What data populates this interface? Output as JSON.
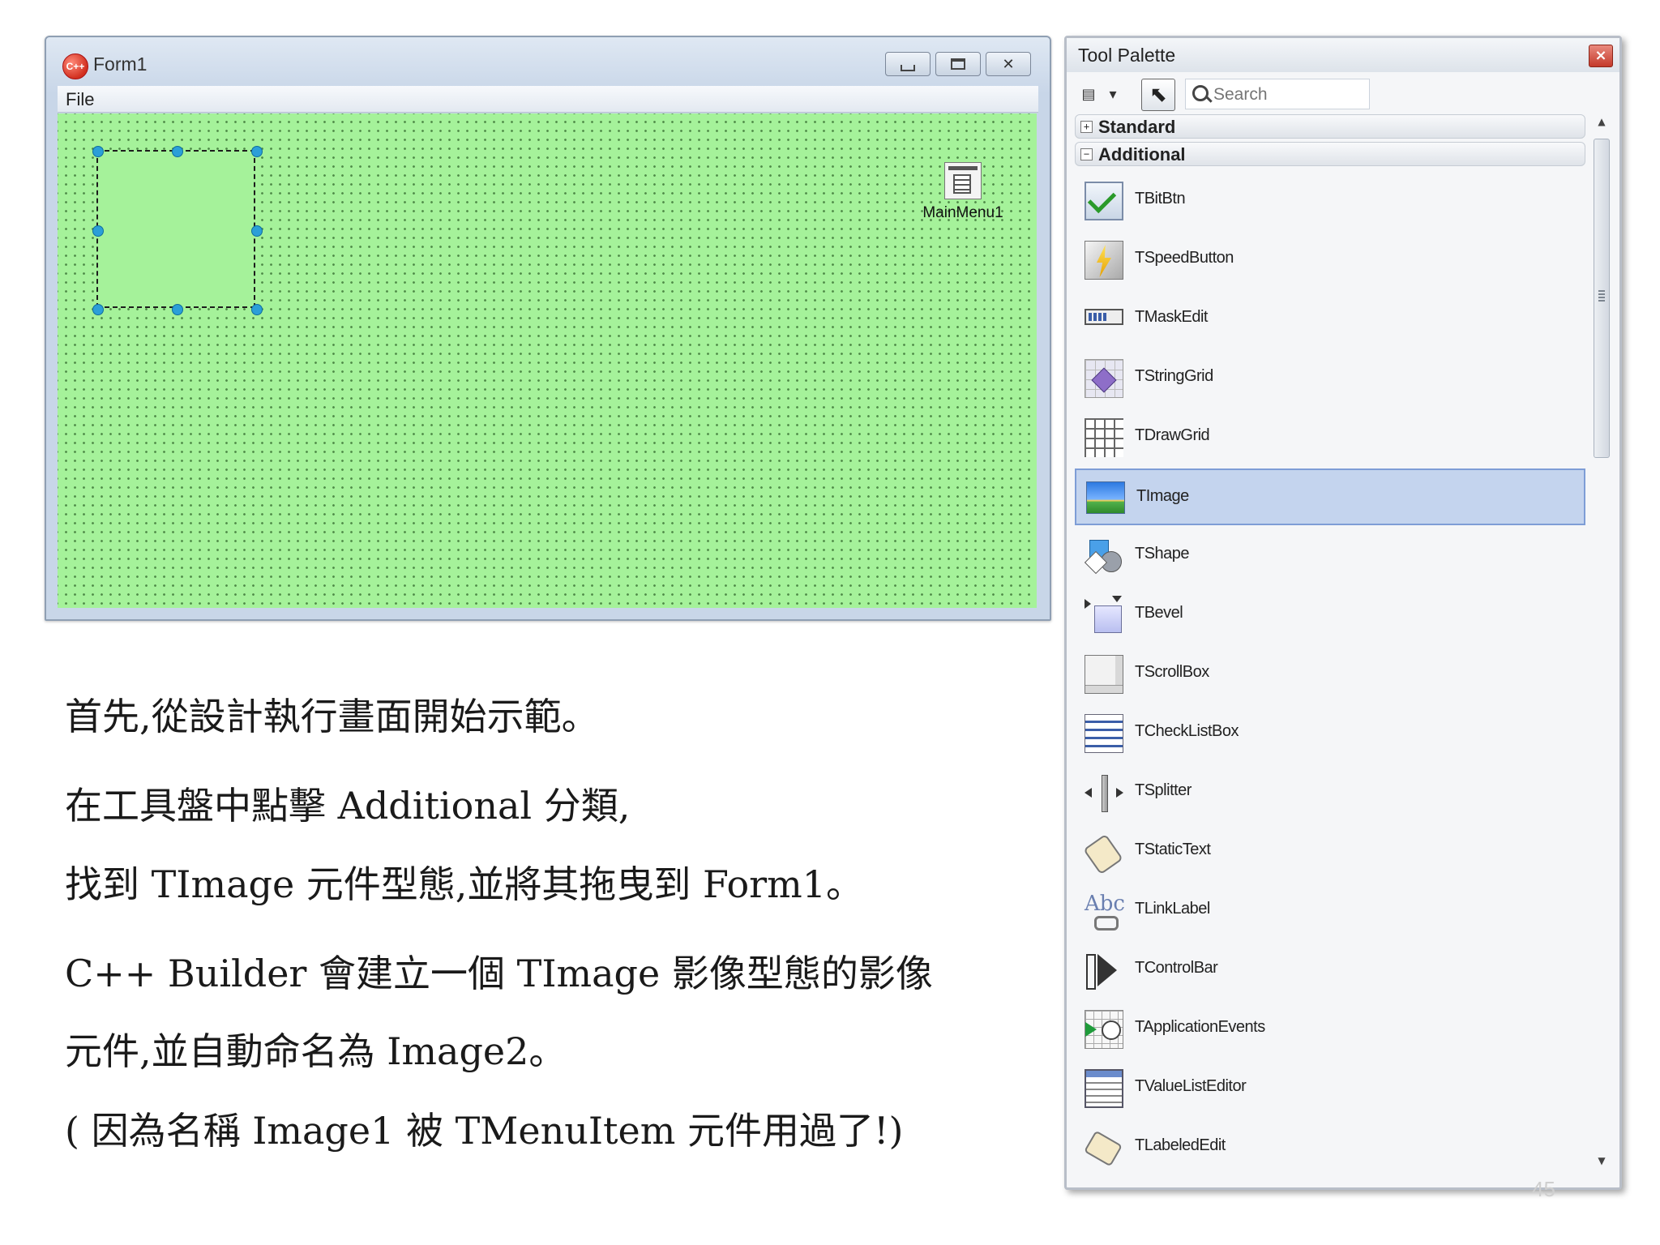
{
  "form_window": {
    "title": "Form1",
    "app_icon_text": "C++",
    "menu": {
      "file": "File"
    },
    "nonvisual_component": {
      "label": "MainMenu1",
      "icon": "mainmenu-icon"
    }
  },
  "caption_lines": [
    "首先,從設計執行畫面開始示範。",
    "在工具盤中點擊 Additional 分類,",
    "找到 TImage 元件型態,並將其拖曳到 Form1。",
    "C++ Builder 會建立一個 TImage 影像型態的影像",
    "元件,並自動命名為 Image2。",
    "( 因為名稱 Image1 被 TMenuItem 元件用過了!)"
  ],
  "tool_palette": {
    "title": "Tool Palette",
    "close_glyph": "×",
    "search_placeholder": "Search",
    "categories": [
      {
        "label": "Standard",
        "toggle": "+",
        "expanded": false
      },
      {
        "label": "Additional",
        "toggle": "−",
        "expanded": true
      }
    ],
    "components": [
      {
        "label": "TBitBtn",
        "icon": "bitbtn-icon"
      },
      {
        "label": "TSpeedButton",
        "icon": "speedbutton-icon"
      },
      {
        "label": "TMaskEdit",
        "icon": "maskedit-icon"
      },
      {
        "label": "TStringGrid",
        "icon": "stringgrid-icon"
      },
      {
        "label": "TDrawGrid",
        "icon": "drawgrid-icon"
      },
      {
        "label": "TImage",
        "icon": "image-icon",
        "selected": true
      },
      {
        "label": "TShape",
        "icon": "shape-icon"
      },
      {
        "label": "TBevel",
        "icon": "bevel-icon"
      },
      {
        "label": "TScrollBox",
        "icon": "scrollbox-icon"
      },
      {
        "label": "TCheckListBox",
        "icon": "checklistbox-icon"
      },
      {
        "label": "TSplitter",
        "icon": "splitter-icon"
      },
      {
        "label": "TStaticText",
        "icon": "statictext-icon"
      },
      {
        "label": "TLinkLabel",
        "icon": "linklabel-icon"
      },
      {
        "label": "TControlBar",
        "icon": "controlbar-icon"
      },
      {
        "label": "TApplicationEvents",
        "icon": "applicationevents-icon"
      },
      {
        "label": "TValueListEditor",
        "icon": "valuelisteditor-icon"
      },
      {
        "label": "TLabeledEdit",
        "icon": "labelededit-icon"
      }
    ]
  },
  "slide_number": "45",
  "colors": {
    "design_surface": "#a5f29a",
    "selection_handle": "#2b9fd8",
    "selected_row": "#c4d4ee"
  }
}
